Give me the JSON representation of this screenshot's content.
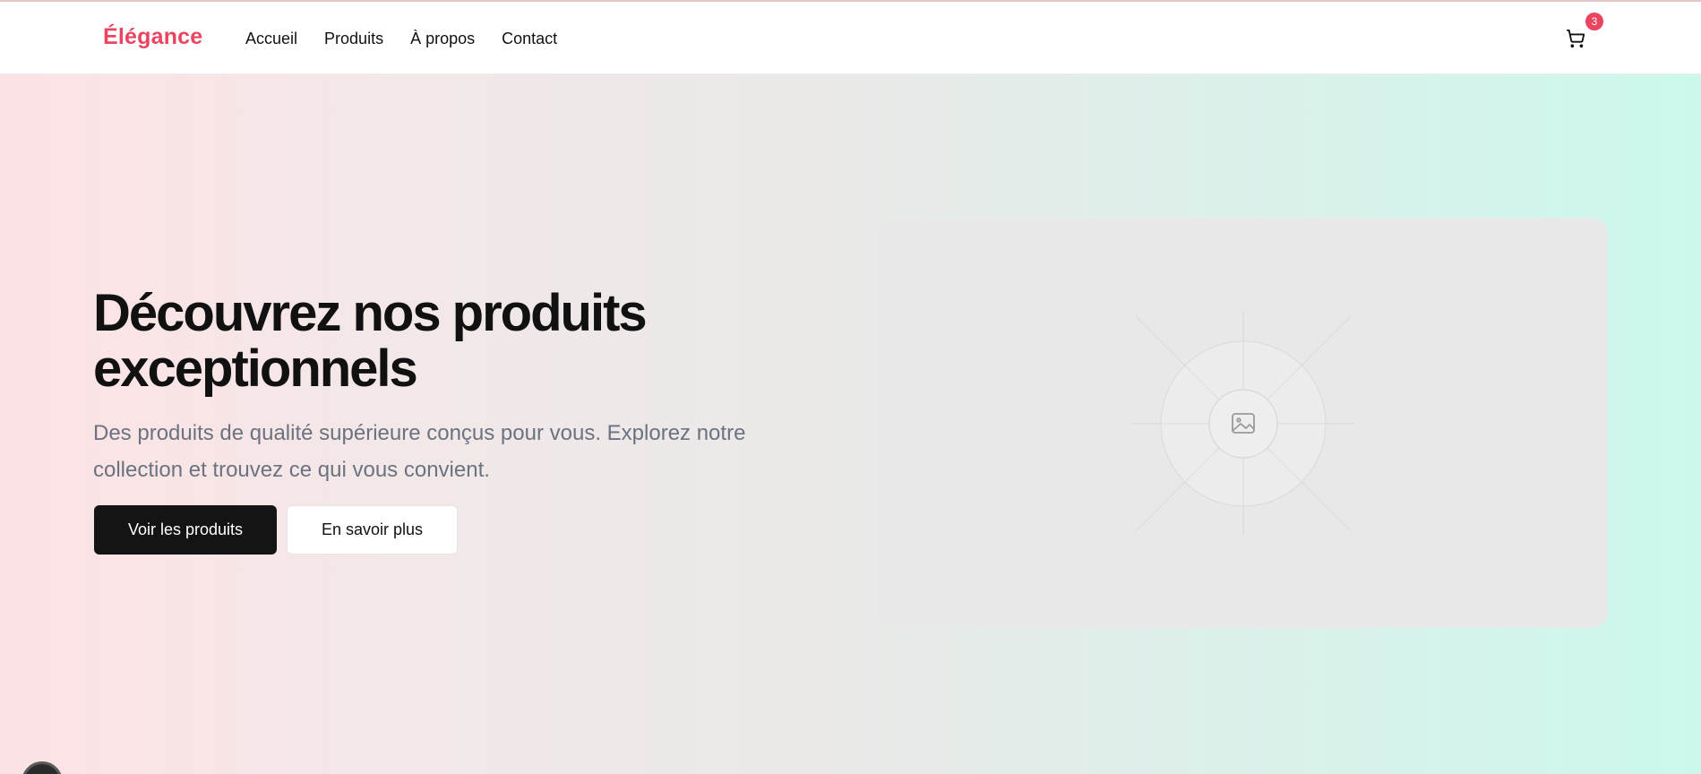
{
  "header": {
    "logo": "Élégance",
    "nav": [
      "Accueil",
      "Produits",
      "À propos",
      "Contact"
    ],
    "cart_count": "3"
  },
  "hero": {
    "title_line1": "Découvrez nos produits",
    "title_line2": "exceptionnels",
    "subtitle_line1": "Des produits de qualité supérieure conçus pour vous. Explorez notre",
    "subtitle_line2": "collection et trouvez ce qui vous convient.",
    "primary_button": "Voir les produits",
    "secondary_button": "En savoir plus"
  },
  "icons": {
    "cart": "shopping-cart-icon",
    "image_placeholder": "image-icon"
  },
  "colors": {
    "accent": "#e94560",
    "primary_button": "#141414",
    "gradient_start": "#fde2e5",
    "gradient_end": "#ccf8ec"
  }
}
